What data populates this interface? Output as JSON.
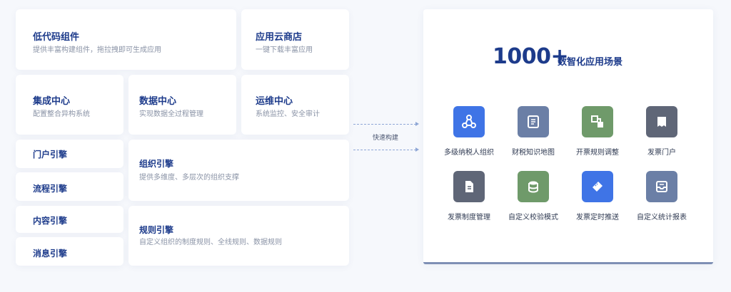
{
  "top": {
    "lowcode": {
      "title": "低代码组件",
      "desc": "提供丰富构建组件，拖拉拽即可生成应用"
    },
    "appstore": {
      "title": "应用云商店",
      "desc": "一键下载丰富应用"
    }
  },
  "middle": {
    "integration": {
      "title": "集成中心",
      "desc": "配置整合异构系统"
    },
    "data": {
      "title": "数据中心",
      "desc": "实现数据全过程管理"
    },
    "ops": {
      "title": "运维中心",
      "desc": "系统监控、安全审计"
    }
  },
  "engines": {
    "portal": "门户引擎",
    "process": "流程引擎",
    "content": "内容引擎",
    "message": "消息引擎",
    "org": {
      "title": "组织引擎",
      "desc": "提供多维度、多层次的组织支撑"
    },
    "rule": {
      "title": "规则引擎",
      "desc": "自定义组织的制度规则、全线规则、数据规则"
    }
  },
  "connector": {
    "label": "快速构建"
  },
  "panel": {
    "number": "1000+",
    "subtitle": "数智化应用场景",
    "scenes": [
      {
        "label": "多级纳税人组织",
        "icon": "tree-icon",
        "color": "#3f74e6"
      },
      {
        "label": "财税知识地图",
        "icon": "book-icon",
        "color": "#6b7fa6"
      },
      {
        "label": "开票规则调整",
        "icon": "blocks-icon",
        "color": "#6f9a6a"
      },
      {
        "label": "发票门户",
        "icon": "receipt-icon",
        "color": "#5f6677"
      },
      {
        "label": "发票制度管理",
        "icon": "document-icon",
        "color": "#5f6677"
      },
      {
        "label": "自定义校验模式",
        "icon": "database-icon",
        "color": "#6f9a6a"
      },
      {
        "label": "发票定时推送",
        "icon": "ticket-icon",
        "color": "#3f74e6"
      },
      {
        "label": "自定义统计报表",
        "icon": "inbox-icon",
        "color": "#6b7fa6"
      }
    ]
  }
}
